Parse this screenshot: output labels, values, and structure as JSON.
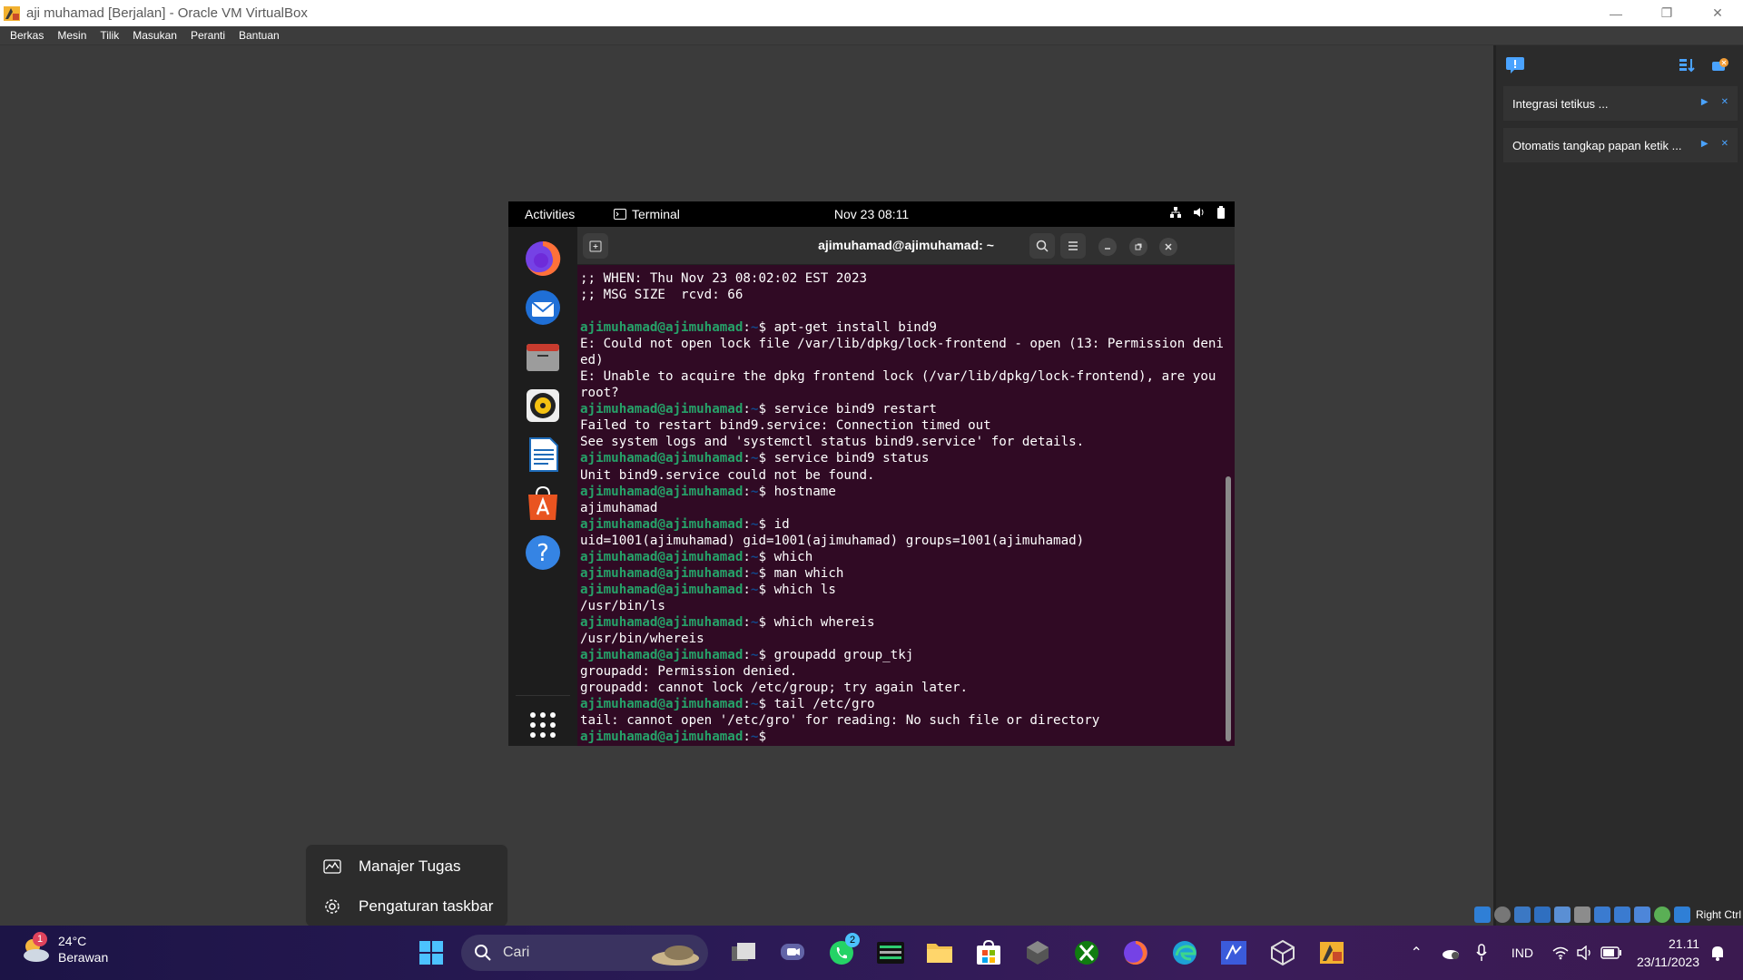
{
  "window": {
    "title": "aji muhamad  [Berjalan] - Oracle VM VirtualBox",
    "minimize": "—",
    "restore": "❐",
    "close": "✕"
  },
  "menubar": [
    "Berkas",
    "Mesin",
    "Tilik",
    "Masukan",
    "Peranti",
    "Bantuan"
  ],
  "gnome": {
    "activities": "Activities",
    "app_name": "Terminal",
    "clock": "Nov 23  08:11"
  },
  "terminal": {
    "title": "ajimuhamad@ajimuhamad: ~",
    "prompt_user": "ajimuhamad@ajimuhamad",
    "lines": [
      {
        "type": "out",
        "text": ";; WHEN: Thu Nov 23 08:02:02 EST 2023"
      },
      {
        "type": "out",
        "text": ";; MSG SIZE  rcvd: 66"
      },
      {
        "type": "out",
        "text": ""
      },
      {
        "type": "cmd",
        "text": "apt-get install bind9"
      },
      {
        "type": "out",
        "text": "E: Could not open lock file /var/lib/dpkg/lock-frontend - open (13: Permission denied)"
      },
      {
        "type": "out",
        "text": "E: Unable to acquire the dpkg frontend lock (/var/lib/dpkg/lock-frontend), are you root?"
      },
      {
        "type": "cmd",
        "text": "service bind9 restart"
      },
      {
        "type": "out",
        "text": "Failed to restart bind9.service: Connection timed out"
      },
      {
        "type": "out",
        "text": "See system logs and 'systemctl status bind9.service' for details."
      },
      {
        "type": "cmd",
        "text": "service bind9 status"
      },
      {
        "type": "out",
        "text": "Unit bind9.service could not be found."
      },
      {
        "type": "cmd",
        "text": "hostname"
      },
      {
        "type": "out",
        "text": "ajimuhamad"
      },
      {
        "type": "cmd",
        "text": "id"
      },
      {
        "type": "out",
        "text": "uid=1001(ajimuhamad) gid=1001(ajimuhamad) groups=1001(ajimuhamad)"
      },
      {
        "type": "cmd",
        "text": "which"
      },
      {
        "type": "cmd",
        "text": "man which"
      },
      {
        "type": "cmd",
        "text": "which ls"
      },
      {
        "type": "out",
        "text": "/usr/bin/ls"
      },
      {
        "type": "cmd",
        "text": "which whereis"
      },
      {
        "type": "out",
        "text": "/usr/bin/whereis"
      },
      {
        "type": "cmd",
        "text": "groupadd group_tkj"
      },
      {
        "type": "out",
        "text": "groupadd: Permission denied."
      },
      {
        "type": "out",
        "text": "groupadd: cannot lock /etc/group; try again later."
      },
      {
        "type": "cmd",
        "text": "tail /etc/gro"
      },
      {
        "type": "out",
        "text": "tail: cannot open '/etc/gro' for reading: No such file or directory"
      },
      {
        "type": "cmd",
        "text": ""
      }
    ]
  },
  "notifications": [
    {
      "text": "Integrasi tetikus ..."
    },
    {
      "text": "Otomatis tangkap papan ketik ..."
    }
  ],
  "statusbar": {
    "host_key": "Right Ctrl"
  },
  "context_menu": {
    "task_manager": "Manajer Tugas",
    "taskbar_settings": "Pengaturan taskbar"
  },
  "taskbar": {
    "weather_temp": "24°C",
    "weather_desc": "Berawan",
    "weather_badge": "1",
    "search_placeholder": "Cari",
    "whatsapp_badge": "2",
    "language": "IND",
    "time": "21.11",
    "date": "23/11/2023"
  },
  "colors": {
    "terminal_bg": "#300a24",
    "prompt_green": "#26a269",
    "path_blue": "#12488b",
    "taskbar": "#2a1a55"
  }
}
